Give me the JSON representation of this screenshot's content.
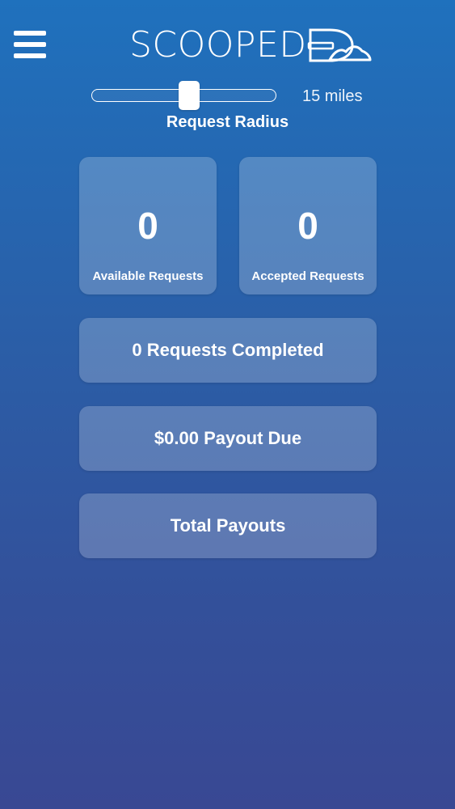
{
  "header": {
    "logo_text": "SCOOPED",
    "menu_icon": "hamburger-menu-icon"
  },
  "radius": {
    "value_label": "15 miles",
    "label": "Request Radius",
    "level_fraction": 0.53
  },
  "stats": {
    "available_count": "0",
    "available_label": "Available Requests",
    "accepted_count": "0",
    "accepted_label": "Accepted Requests"
  },
  "summary": {
    "completed": "0 Requests Completed",
    "payout_due": "$0.00 Payout Due",
    "total_payouts": "Total Payouts"
  },
  "colors": {
    "gradient_top": "#1f71bd",
    "gradient_bottom": "#394893",
    "card_fill": "rgba(255,255,255,0.22)"
  }
}
